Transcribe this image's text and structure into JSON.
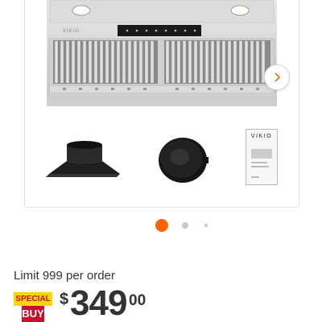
{
  "product_gallery": {
    "main_image_icon": "range-hood-icon",
    "next_icon": "chevron-right-icon",
    "accessories": [
      "duct-adapter-icon",
      "charcoal-filter-icon",
      "manual-booklet-icon"
    ],
    "hood_brand": "VIKIO",
    "manual_brand": "VIKIO",
    "pagination": {
      "total_visible": 3,
      "active_index": 0
    }
  },
  "purchase": {
    "limit_text": "Limit 999 per order",
    "badge_top": "SPECIAL",
    "badge_bottom": "BUY",
    "currency_symbol": "$",
    "price_dollars": "349",
    "price_cents": "00"
  },
  "colors": {
    "accent": "#f96302",
    "badge_yellow": "#ffd400",
    "badge_red": "#c8102e",
    "text": "#333333"
  }
}
